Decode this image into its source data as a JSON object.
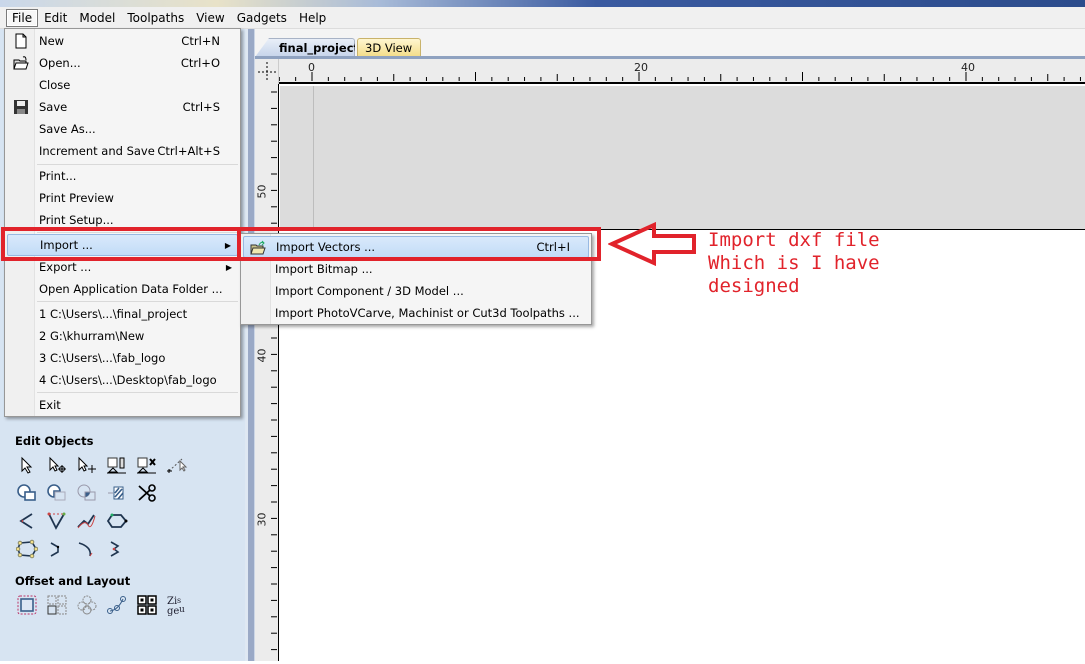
{
  "menubar": {
    "items": [
      "File",
      "Edit",
      "Model",
      "Toolpaths",
      "View",
      "Gadgets",
      "Help"
    ],
    "active": "File"
  },
  "tabs": [
    {
      "label": "final_project",
      "active": true
    },
    {
      "label": "3D View",
      "active": false
    }
  ],
  "rulers": {
    "horizontal_labels": [
      "0",
      "20",
      "40"
    ],
    "vertical_labels": [
      "50",
      "40",
      "30"
    ]
  },
  "file_menu": {
    "items": [
      {
        "label": "New",
        "shortcut": "Ctrl+N",
        "icon": "new-file-icon"
      },
      {
        "label": "Open...",
        "shortcut": "Ctrl+O",
        "icon": "open-folder-icon"
      },
      {
        "label": "Close",
        "shortcut": ""
      },
      {
        "label": "Save",
        "shortcut": "Ctrl+S",
        "icon": "save-icon"
      },
      {
        "label": "Save As...",
        "shortcut": ""
      },
      {
        "label": "Increment and Save",
        "shortcut": "Ctrl+Alt+S"
      },
      {
        "label": "Print...",
        "shortcut": ""
      },
      {
        "label": "Print Preview",
        "shortcut": ""
      },
      {
        "label": "Print Setup...",
        "shortcut": ""
      },
      {
        "label": "Import ...",
        "shortcut": "",
        "submenu": true,
        "highlighted": true
      },
      {
        "label": "Export ...",
        "shortcut": "",
        "submenu": true
      },
      {
        "label": "Open Application Data Folder ...",
        "shortcut": ""
      },
      {
        "label": "1 C:\\Users\\...\\final_project",
        "shortcut": ""
      },
      {
        "label": "2 G:\\khurram\\New",
        "shortcut": ""
      },
      {
        "label": "3 C:\\Users\\...\\fab_logo",
        "shortcut": ""
      },
      {
        "label": "4 C:\\Users\\...\\Desktop\\fab_logo",
        "shortcut": ""
      },
      {
        "label": "Exit",
        "shortcut": ""
      }
    ]
  },
  "import_submenu": {
    "items": [
      {
        "label": "Import Vectors ...",
        "shortcut": "Ctrl+I",
        "icon": "import-vectors-icon",
        "highlighted": true
      },
      {
        "label": "Import Bitmap ...",
        "shortcut": ""
      },
      {
        "label": "Import Component / 3D Model ...",
        "shortcut": ""
      },
      {
        "label": "Import PhotoVCarve, Machinist or Cut3d Toolpaths ...",
        "shortcut": ""
      }
    ]
  },
  "left_panel": {
    "edit_objects_title": "Edit Objects",
    "edit_objects_tools": [
      [
        "select-icon",
        "node-edit-icon",
        "transform-icon",
        "align-icon",
        "delete-align-icon",
        "measure-icon"
      ],
      [
        "weld-icon",
        "subtract-icon",
        "intersect-icon",
        "trim-icon",
        "scissors-icon"
      ],
      [
        "fillet-icon",
        "close-vector-icon",
        "smooth-icon",
        "join-vector-icon"
      ],
      [
        "polyline-nodes-icon",
        "curve-node-icon",
        "bezier-icon",
        "arc-icon"
      ]
    ],
    "offset_layout_title": "Offset and Layout",
    "offset_layout_tools": [
      "offset-icon",
      "array-copy-icon",
      "circular-array-icon",
      "copy-along-icon",
      "nesting-icon",
      "text-layout-icon"
    ]
  },
  "annotation": {
    "text": "Import dxf file\nWhich is I have\ndesigned",
    "color": "#e1232b"
  },
  "colors": {
    "highlight": "#c2dcf7",
    "annotation_red": "#e1232b",
    "panel_bg": "#d7e4f2"
  }
}
